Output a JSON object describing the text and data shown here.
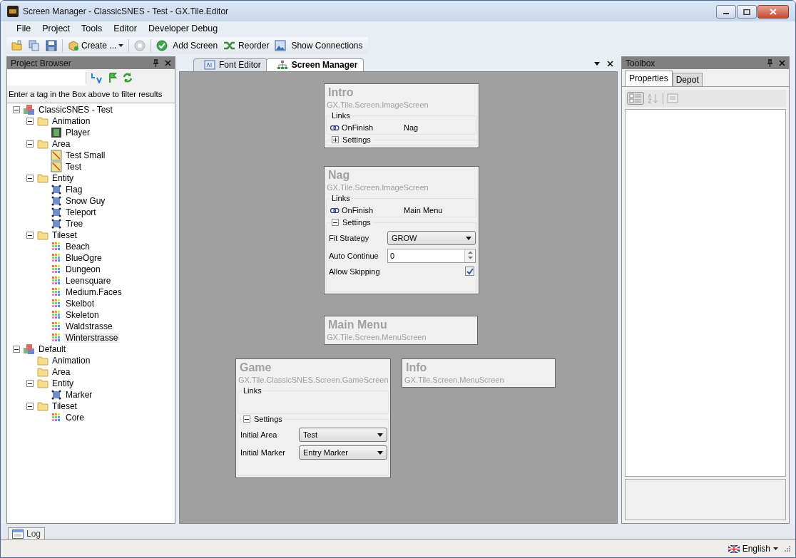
{
  "window": {
    "title": "Screen Manager - ClassicSNES - Test - GX.Tile.Editor"
  },
  "menu": [
    "File",
    "Project",
    "Tools",
    "Editor",
    "Developer Debug"
  ],
  "toolbar": {
    "create": {
      "label": "Create ..."
    },
    "help": {
      "disabled": true
    },
    "actions": [
      {
        "label": "Add Screen"
      },
      {
        "label": "Reorder"
      },
      {
        "label": "Show Connections"
      }
    ]
  },
  "project_browser": {
    "title": "Project Browser",
    "hint": "Enter a tag in the Box above to filter results",
    "tree": [
      {
        "label": "ClassicSNES - Test",
        "kind": "project",
        "expanded": true,
        "selected": false,
        "children": [
          {
            "label": "Animation",
            "kind": "folder",
            "expanded": true,
            "selected": false,
            "children": [
              {
                "label": "Player",
                "kind": "animation",
                "selected": false
              }
            ]
          },
          {
            "label": "Area",
            "kind": "folder",
            "expanded": true,
            "selected": false,
            "children": [
              {
                "label": "Test Small",
                "kind": "area",
                "selected": false
              },
              {
                "label": "Test",
                "kind": "area",
                "selected": false
              }
            ]
          },
          {
            "label": "Entity",
            "kind": "folder",
            "expanded": true,
            "selected": false,
            "children": [
              {
                "label": "Flag",
                "kind": "entity",
                "selected": false
              },
              {
                "label": "Snow Guy",
                "kind": "entity",
                "selected": false
              },
              {
                "label": "Teleport",
                "kind": "entity",
                "selected": false
              },
              {
                "label": "Tree",
                "kind": "entity",
                "selected": false
              }
            ]
          },
          {
            "label": "Tileset",
            "kind": "folder",
            "expanded": true,
            "selected": false,
            "children": [
              {
                "label": "Beach",
                "kind": "tileset",
                "selected": false
              },
              {
                "label": "BlueOgre",
                "kind": "tileset",
                "selected": false
              },
              {
                "label": "Dungeon",
                "kind": "tileset",
                "selected": false
              },
              {
                "label": "Leensquare",
                "kind": "tileset",
                "selected": false
              },
              {
                "label": "Medium.Faces",
                "kind": "tileset",
                "selected": false
              },
              {
                "label": "Skelbot",
                "kind": "tileset",
                "selected": false
              },
              {
                "label": "Skeleton",
                "kind": "tileset",
                "selected": false
              },
              {
                "label": "Waldstrasse",
                "kind": "tileset",
                "selected": false
              },
              {
                "label": "Winterstrasse",
                "kind": "tileset",
                "selected": true
              }
            ]
          }
        ]
      },
      {
        "label": "Default",
        "kind": "project",
        "expanded": true,
        "selected": false,
        "children": [
          {
            "label": "Animation",
            "kind": "folder",
            "selected": false
          },
          {
            "label": "Area",
            "kind": "folder",
            "selected": false
          },
          {
            "label": "Entity",
            "kind": "folder",
            "expanded": true,
            "selected": false,
            "children": [
              {
                "label": "Marker",
                "kind": "entity",
                "selected": false
              }
            ]
          },
          {
            "label": "Tileset",
            "kind": "folder",
            "expanded": true,
            "selected": false,
            "children": [
              {
                "label": "Core",
                "kind": "tileset",
                "selected": false
              }
            ]
          }
        ]
      }
    ]
  },
  "editor_tabs": [
    {
      "label": "Font Editor",
      "selected": false
    },
    {
      "label": "Screen Manager",
      "selected": true
    }
  ],
  "screens": [
    {
      "name": "Intro",
      "type": "GX.Tile.Screen.ImageScreen",
      "links_label": "Links",
      "links": [
        {
          "event": "OnFinish",
          "target": "Nag"
        }
      ],
      "settings": {
        "label": "Settings",
        "expanded": false
      }
    },
    {
      "name": "Nag",
      "type": "GX.Tile.Screen.ImageScreen",
      "links_label": "Links",
      "links": [
        {
          "event": "OnFinish",
          "target": "Main Menu"
        }
      ],
      "settings": {
        "label": "Settings",
        "expanded": true,
        "fields": [
          {
            "kind": "select",
            "label": "Fit Strategy",
            "value": "GROW"
          },
          {
            "kind": "number",
            "label": "Auto Continue",
            "value": "0"
          },
          {
            "kind": "checkbox",
            "label": "Allow Skipping",
            "checked": true
          }
        ]
      }
    },
    {
      "name": "Main Menu",
      "type": "GX.Tile.Screen.MenuScreen"
    },
    {
      "name": "Game",
      "type": "GX.Tile.ClassicSNES.Screen.GameScreen",
      "links_label": "Links",
      "settings": {
        "label": "Settings",
        "expanded": true,
        "fields": [
          {
            "kind": "select",
            "label": "Initial Area",
            "value": "Test"
          },
          {
            "kind": "select",
            "label": "Initial Marker",
            "value": "Entry Marker"
          }
        ]
      }
    },
    {
      "name": "Info",
      "type": "GX.Tile.Screen.MenuScreen"
    }
  ],
  "toolbox": {
    "title": "Toolbox",
    "tabs": [
      {
        "label": "Properties",
        "selected": true
      },
      {
        "label": "Depot",
        "selected": false
      }
    ]
  },
  "log_tab": {
    "label": "Log"
  },
  "status_bar": {
    "language": "English"
  }
}
